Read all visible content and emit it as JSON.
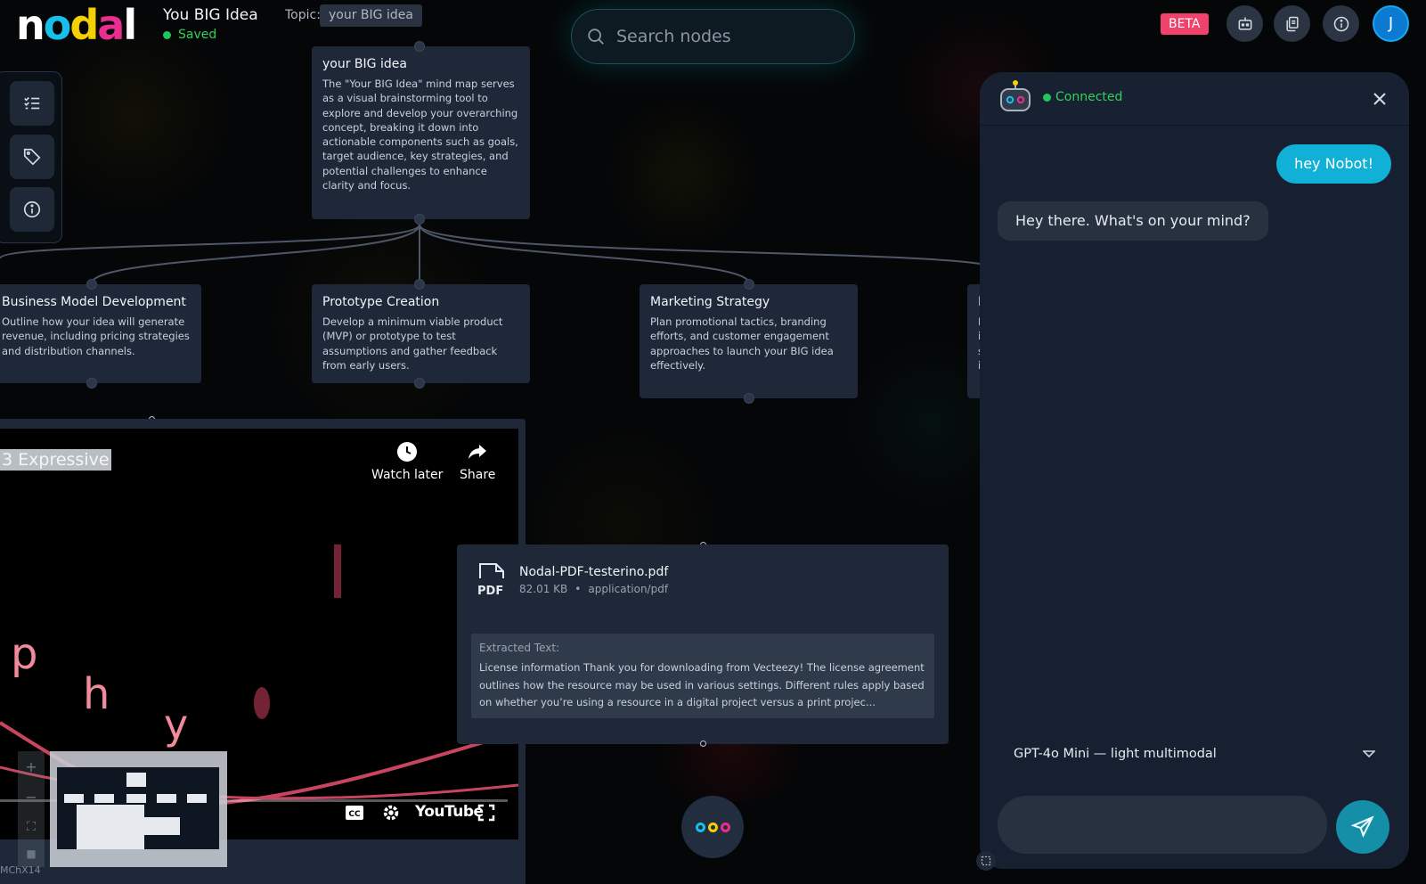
{
  "header": {
    "logo_letters": [
      "n",
      "o",
      "d",
      "a",
      "l"
    ],
    "logo_colors": [
      "#ffffff",
      "#16c0e8",
      "#f5d000",
      "#ea2e8f",
      "#ffffff"
    ],
    "doc_title": "You BIG Idea",
    "saved_status": "Saved",
    "topic_label": "Topic:",
    "topic_value": "your BIG idea",
    "beta_badge": "BETA",
    "avatar_initial": "J"
  },
  "search": {
    "placeholder": "Search nodes"
  },
  "left_toolbar": {
    "icons": [
      "checklist-icon",
      "tag-icon",
      "info-icon"
    ]
  },
  "nodes": {
    "root": {
      "title": "your BIG idea",
      "description": "The \"Your BIG Idea\" mind map serves as a visual brainstorming tool to explore and develop your overarching concept, breaking it down into actionable components such as goals, target audience, key strategies, and potential challenges to enhance clarity and focus."
    },
    "business": {
      "title": "Business Model Development",
      "description": "Outline how your idea will generate revenue, including pricing strategies and distribution channels."
    },
    "prototype": {
      "title": "Prototype Creation",
      "description": "Develop a minimum viable product (MVP) or prototype to test assumptions and gather feedback from early users."
    },
    "marketing": {
      "title": "Marketing Strategy",
      "description": "Plan promotional tactics, branding efforts, and customer engagement approaches to launch your BIG idea effectively."
    },
    "partial_fourth": {
      "title_visible": "F",
      "lines_visible": [
        "E",
        "i",
        "s",
        "i"
      ]
    }
  },
  "video": {
    "title": "3 Expressive",
    "watch_later": "Watch later",
    "share": "Share",
    "letters": [
      "p",
      "h",
      "y"
    ],
    "youtube_label": "YouTube",
    "video_id": "MChX14"
  },
  "pdf": {
    "file_name": "Nodal-PDF-testerino.pdf",
    "file_size": "82.01 KB",
    "mime_type": "application/pdf",
    "icon_label": "PDF",
    "extracted_label": "Extracted Text:",
    "extracted_text": "License information Thank you for downloading from Vecteezy! The license agreement outlines how the resource may be used in various settings. Different rules apply based on whether you’re using a resource in a digital project versus a print projec..."
  },
  "chat": {
    "status": "Connected",
    "messages": [
      {
        "role": "user",
        "text": "hey Nobot!"
      },
      {
        "role": "assistant",
        "text": "Hey there. What's on your mind?"
      }
    ],
    "model": "GPT-4o Mini — light multimodal",
    "input_value": ""
  },
  "colors": {
    "accent_cyan": "#11b1d7",
    "beta_pink": "#f0426b",
    "status_green": "#34d058",
    "node_bg": "#1e2838"
  }
}
